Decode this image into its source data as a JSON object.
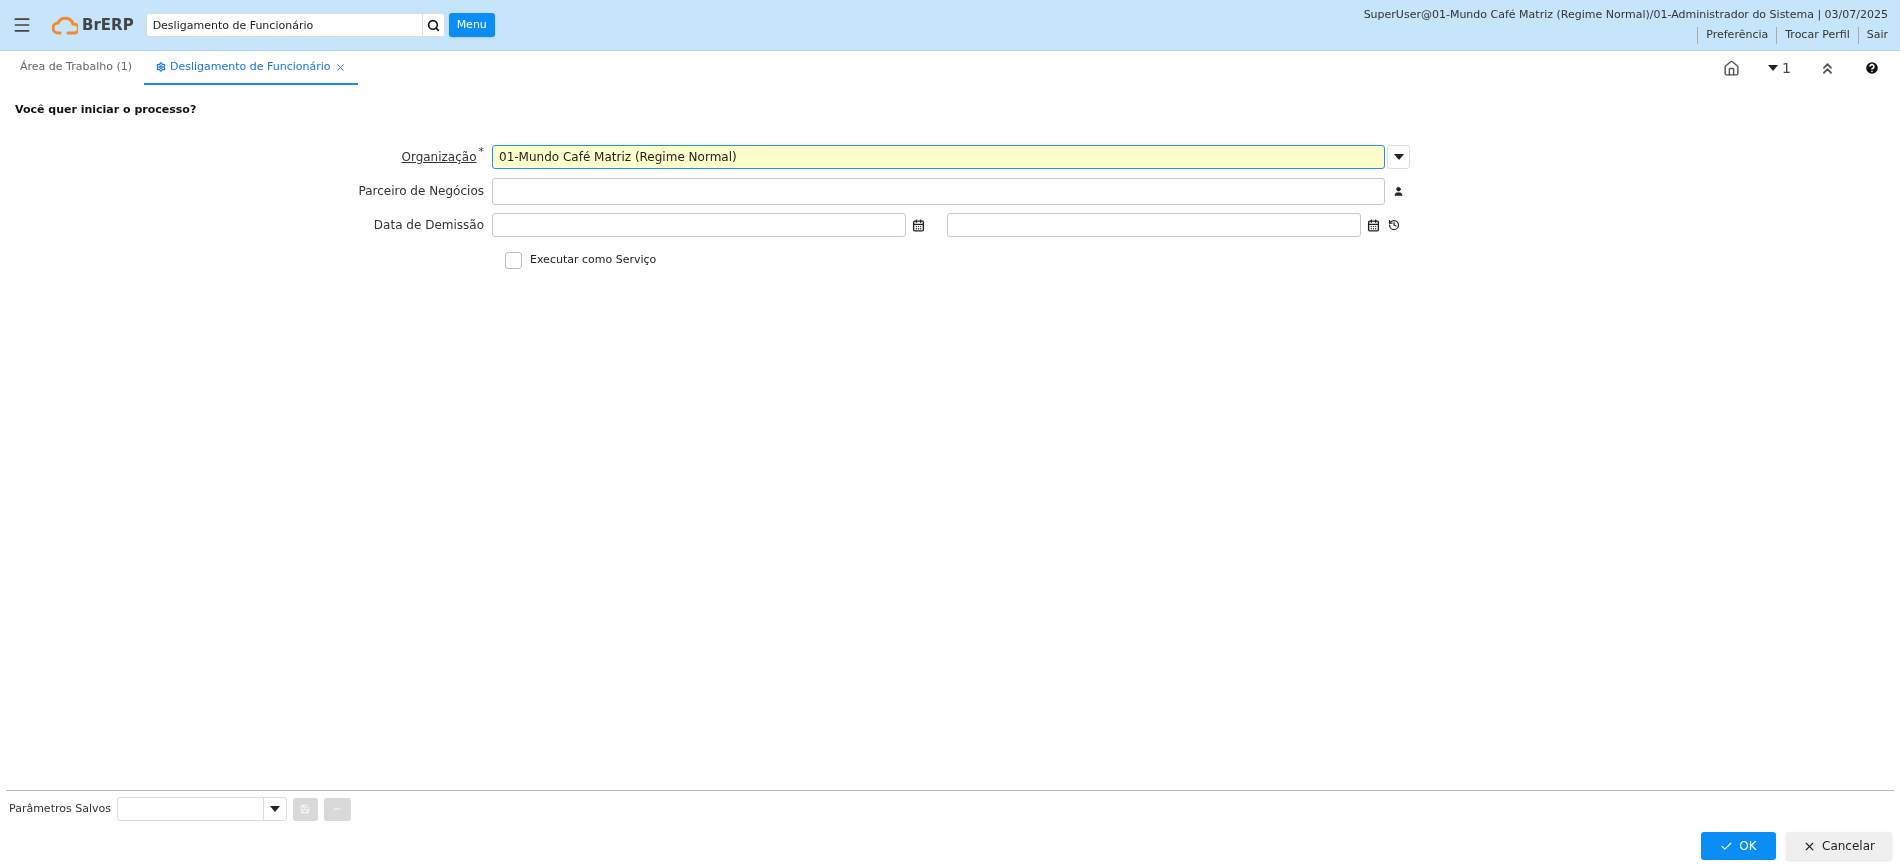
{
  "header": {
    "logo_text": "BrERP",
    "search_value": "Desligamento de Funcionário",
    "menu_button": "Menu",
    "user_info": "SuperUser@01-Mundo Café Matriz (Regime Normal)/01-Administrador do Sistema | 03/07/2025",
    "links": [
      "Preferência",
      "Trocar Perfil",
      "Sair"
    ]
  },
  "tabs": [
    {
      "label": "Área de Trabalho (1)",
      "selected": false,
      "closable": false,
      "icon": false
    },
    {
      "label": "Desligamento de Funcionário",
      "selected": true,
      "closable": true,
      "icon": true
    }
  ],
  "toolbar": {
    "count": "1"
  },
  "process": {
    "question": "Você quer iniciar o processo?",
    "fields": [
      {
        "kind": "select",
        "label": "Organização",
        "required_mark": "*",
        "value": "01-Mundo Café Matriz (Regime Normal)",
        "focused": true
      },
      {
        "kind": "search",
        "label": "Parceiro de Negócios",
        "focused": false
      },
      {
        "kind": "daterange",
        "label": "Data de Demissão",
        "focused": false
      }
    ],
    "checkbox": {
      "label": "Executar como Serviço",
      "checked": false
    }
  },
  "footer": {
    "saved_params_label": "Parâmetros Salvos",
    "ok": "OK",
    "cancel": "Cancelar"
  }
}
